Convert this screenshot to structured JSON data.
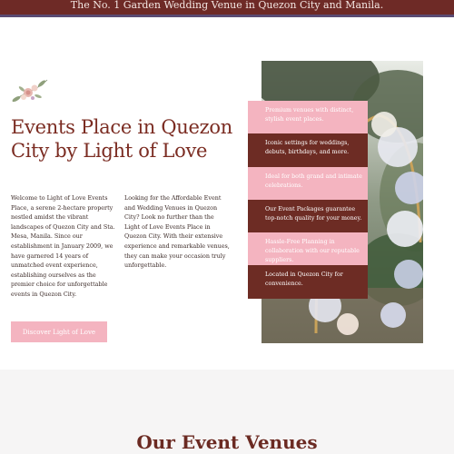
{
  "banner": {
    "text": "The No. 1 Garden Wedding Venue in Quezon City and Manila."
  },
  "hero": {
    "heading": "Events Place in Quezon City by Light of Love",
    "paragraph_left": "Welcome to Light of Love Events Place, a serene 2-hectare property nestled amidst the vibrant landscapes of Quezon City and Sta. Mesa, Manila. Since our establishment in January 2009, we have garnered 14 years of unmatched event experience, establishing ourselves as the premier choice for unforgettable events in Quezon City.",
    "paragraph_right": "Looking for the Affordable Event and Wedding Venues in Quezon City? Look no further than the Light of Love Events Place in Quezon City. With their extensive experience and remarkable venues, they can make your occasion truly unforgettable.",
    "cta_label": "Discover Light of Love"
  },
  "features": [
    {
      "text": "Premium venues with distinct, stylish event places.",
      "style": "pink"
    },
    {
      "text": "Iconic settings for weddings, debuts, birthdays, and more.",
      "style": "dark"
    },
    {
      "text": "Ideal for both grand and intimate celebrations.",
      "style": "pink"
    },
    {
      "text": "Our Event Packages guarantee top-notch quality for your money.",
      "style": "dark"
    },
    {
      "text": "Hassle-Free Planning in collaboration with our reputable suppliers.",
      "style": "pink"
    },
    {
      "text": "Located in Quezon City for convenience.",
      "style": "dark"
    }
  ],
  "venues": {
    "title": "Our Event Venues"
  },
  "colors": {
    "brand_dark": "#6d2c24",
    "brand_pink": "#f4b4c0",
    "banner": "#6e2a26"
  }
}
